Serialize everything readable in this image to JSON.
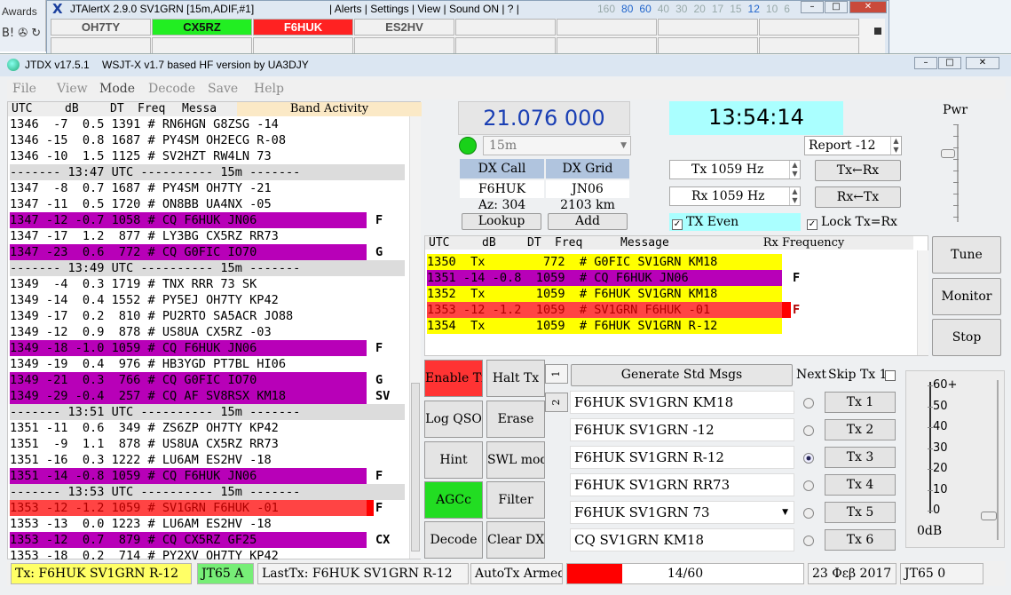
{
  "colors": {
    "cq": "#b800b8",
    "tx": "#ffff00",
    "error": "#ff4444",
    "clock_bg": "#aaffff",
    "freq_text": "#1a3fb4",
    "enable_tx": "#ff3333",
    "agc": "#22dd22"
  },
  "background": {
    "awards": "Awards",
    "icons": "B! ✇ ↻"
  },
  "jtalert": {
    "title": "JTAlertX 2.9.0 SV1GRN [15m,ADIF,#1]",
    "menu": "| Alerts | Settings | View | Sound ON | ? |",
    "bands": [
      "160",
      "80",
      "60",
      "40",
      "30",
      "20",
      "17",
      "15",
      "12",
      "10",
      "6"
    ],
    "calls": [
      {
        "call": "OH7TY",
        "color": "#f1f1f1"
      },
      {
        "call": "CX5RZ",
        "color": "#22ee22"
      },
      {
        "call": "F6HUK",
        "color": "#ff2222"
      },
      {
        "call": "ES2HV",
        "color": "#f1f1f1"
      }
    ]
  },
  "jtdx": {
    "title": "JTDX v17.5.1",
    "subtitle": "WSJT-X v1.7 based HF version by UA3DJY",
    "menu": [
      "File",
      "View",
      "Mode",
      "Decode",
      "Save",
      "Help"
    ]
  },
  "band_activity": {
    "title": "Band Activity",
    "header": {
      "utc": "UTC",
      "db": "dB",
      "dt": "DT",
      "freq": "Freq",
      "msg": "Messa"
    },
    "rows": [
      {
        "t": "1346  -7  0.5 1391 # RN6HGN G8ZSG -14",
        "k": "n",
        "f": ""
      },
      {
        "t": "1346 -15  0.8 1687 # PY4SM OH2ECG R-08",
        "k": "n",
        "f": ""
      },
      {
        "t": "1346 -10  1.5 1125 # SV2HZT RW4LN 73",
        "k": "n",
        "f": ""
      },
      {
        "t": "------- 13:47 UTC ---------- 15m -------",
        "k": "s",
        "f": ""
      },
      {
        "t": "1347  -8  0.7 1687 # PY4SM OH7TY -21",
        "k": "n",
        "f": ""
      },
      {
        "t": "1347 -11  0.5 1720 # ON8BB UA4NX -05",
        "k": "n",
        "f": ""
      },
      {
        "t": "1347 -12 -0.7 1058 # CQ F6HUK JN06",
        "k": "c",
        "f": "F"
      },
      {
        "t": "1347 -17  1.2  877 # LY3BG CX5RZ RR73",
        "k": "n",
        "f": ""
      },
      {
        "t": "1347 -23  0.6  772 # CQ G0FIC IO70",
        "k": "c",
        "f": "G"
      },
      {
        "t": "------- 13:49 UTC ---------- 15m -------",
        "k": "s",
        "f": ""
      },
      {
        "t": "1349  -4  0.3 1719 # TNX RRR 73 SK",
        "k": "n",
        "f": ""
      },
      {
        "t": "1349 -14  0.4 1552 # PY5EJ OH7TY KP42",
        "k": "n",
        "f": ""
      },
      {
        "t": "1349 -17  0.2  810 # PU2RTO SA5ACR JO88",
        "k": "n",
        "f": ""
      },
      {
        "t": "1349 -12  0.9  878 # US8UA CX5RZ -03",
        "k": "n",
        "f": ""
      },
      {
        "t": "1349 -18 -1.0 1059 # CQ F6HUK JN06",
        "k": "c",
        "f": "F"
      },
      {
        "t": "1349 -19  0.4  976 # HB3YGD PT7BL HI06",
        "k": "n",
        "f": ""
      },
      {
        "t": "1349 -21  0.3  766 # CQ G0FIC IO70",
        "k": "c",
        "f": "G"
      },
      {
        "t": "1349 -29 -0.4  257 # CQ AF SV8RSX KM18",
        "k": "c",
        "f": "SV"
      },
      {
        "t": "------- 13:51 UTC ---------- 15m -------",
        "k": "s",
        "f": ""
      },
      {
        "t": "1351 -11  0.6  349 # ZS6ZP OH7TY KP42",
        "k": "n",
        "f": ""
      },
      {
        "t": "1351  -9  1.1  878 # US8UA CX5RZ RR73",
        "k": "n",
        "f": ""
      },
      {
        "t": "1351 -16  0.3 1222 # LU6AM ES2HV -18",
        "k": "n",
        "f": ""
      },
      {
        "t": "1351 -14 -0.8 1059 # CQ F6HUK JN06",
        "k": "c",
        "f": "F"
      },
      {
        "t": "------- 13:53 UTC ---------- 15m -------",
        "k": "s",
        "f": ""
      },
      {
        "t": "1353 -12 -1.2 1059 # SV1GRN F6HUK -01",
        "k": "r",
        "f": "F"
      },
      {
        "t": "1353 -13  0.0 1223 # LU6AM ES2HV -18",
        "k": "n",
        "f": ""
      },
      {
        "t": "1353 -12  0.7  879 # CQ CX5RZ GF25",
        "k": "c",
        "f": "CX"
      },
      {
        "t": "1353 -18  0.2  714 # PY2XV OH7TY KP42",
        "k": "n",
        "f": ""
      }
    ]
  },
  "controls": {
    "frequency": "21.076 000",
    "clock": "13:54:14",
    "band": "15m",
    "dx_call_label": "DX Call",
    "dx_grid_label": "DX Grid",
    "dx_call": "F6HUK",
    "dx_grid": "JN06",
    "az": "Az: 304",
    "dist": "2103 km",
    "lookup": "Lookup",
    "add": "Add",
    "report": "Report -12",
    "tx_freq": "Tx  1059  Hz",
    "rx_freq": "Rx  1059  Hz",
    "tx_from_rx": "Tx←Rx",
    "rx_from_tx": "Rx←Tx",
    "tx_even": "TX Even",
    "lock": "Lock Tx=Rx",
    "pwr": "Pwr",
    "tune": "Tune",
    "monitor": "Monitor",
    "stop": "Stop"
  },
  "rx_frequency": {
    "title": "Rx Frequency",
    "header": {
      "utc": "UTC",
      "db": "dB",
      "dt": "DT",
      "freq": "Freq",
      "msg": "Message"
    },
    "rows": [
      {
        "t": "1350  Tx        772  # G0FIC SV1GRN KM18",
        "k": "y",
        "f": ""
      },
      {
        "t": "1351 -14 -0.8  1059  # CQ F6HUK JN06",
        "k": "p",
        "f": "F"
      },
      {
        "t": "1352  Tx       1059  # F6HUK SV1GRN KM18",
        "k": "y",
        "f": ""
      },
      {
        "t": "1353 -12 -1.2  1059  # SV1GRN F6HUK -01",
        "k": "r",
        "f": "F"
      },
      {
        "t": "1354  Tx       1059  # F6HUK SV1GRN R-12",
        "k": "y",
        "f": ""
      }
    ]
  },
  "buttons": {
    "enable_tx": "Enable Tx",
    "halt_tx": "Halt Tx",
    "log_qso": "Log QSO",
    "erase": "Erase",
    "hint": "Hint",
    "swl": "SWL mode",
    "agcc": "AGCc",
    "filter": "Filter",
    "decode": "Decode",
    "clear_dx": "Clear DX",
    "tab1": "1",
    "tab2": "2"
  },
  "messages": {
    "generate": "Generate Std Msgs",
    "next": "Next",
    "skip": "Skip Tx 1",
    "tx": [
      {
        "text": "F6HUK SV1GRN KM18",
        "btn": "Tx 1",
        "selected": false
      },
      {
        "text": "F6HUK SV1GRN -12",
        "btn": "Tx 2",
        "selected": false
      },
      {
        "text": "F6HUK SV1GRN R-12",
        "btn": "Tx 3",
        "selected": true
      },
      {
        "text": "F6HUK SV1GRN RR73",
        "btn": "Tx 4",
        "selected": false
      },
      {
        "text": "F6HUK SV1GRN 73",
        "btn": "Tx 5",
        "selected": false
      },
      {
        "text": "CQ SV1GRN KM18",
        "btn": "Tx 6",
        "selected": false
      }
    ]
  },
  "meter": {
    "labels": [
      "60+",
      "50",
      "40",
      "30",
      "20",
      "10",
      "0"
    ],
    "unit": "0dB"
  },
  "status": {
    "tx": "Tx: F6HUK SV1GRN R-12",
    "mode": "JT65 A",
    "last": "LastTx: F6HUK SV1GRN R-12",
    "auto": "AutoTx Armed",
    "progress": "14/60",
    "progress_value": 0.233,
    "date": "23 Φεβ 2017",
    "jt": "JT65  0"
  }
}
